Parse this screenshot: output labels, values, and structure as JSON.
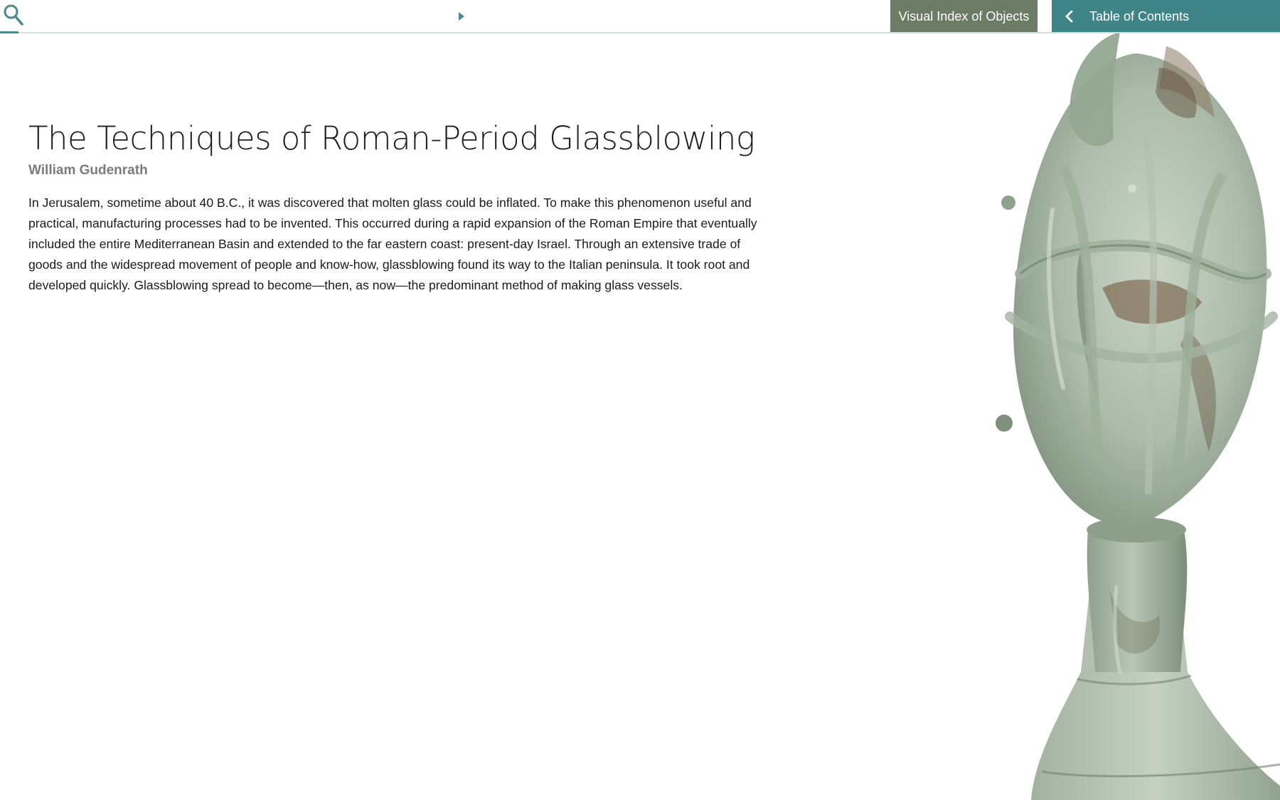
{
  "topbar": {
    "search_icon": "search-icon",
    "play_icon": "play-triangle-icon",
    "visual_index_label": "Visual Index of Objects",
    "toc_label": "Table of Contents",
    "toc_icon": "chevron-left-icon"
  },
  "article": {
    "title": "The Techniques of Roman-Period Glassblowing",
    "author": "William Gudenrath",
    "paragraph": "In Jerusalem, sometime about 40 B.C., it was discovered that molten glass could be inflated. To make this phenomenon useful and practical, manufacturing processes had to be invented. This occurred during a rapid expansion of the Roman Empire that eventually included the entire Mediterranean Basin and extended to the far eastern coast: present-day Israel. Through an extensive trade of goods and the widespread movement of people and know-how, glassblowing found its way to the Italian peninsula. It took root and developed quickly. Glassblowing spread to become—then, as now—the predominant method of making glass vessels."
  },
  "colors": {
    "accent_teal": "#3f8588",
    "visual_index_bg": "#6b7b66",
    "author_gray": "#7b7b7b",
    "glass_green": "#a9b8a7"
  },
  "hero_image": {
    "subject": "green-glass-vessel"
  }
}
